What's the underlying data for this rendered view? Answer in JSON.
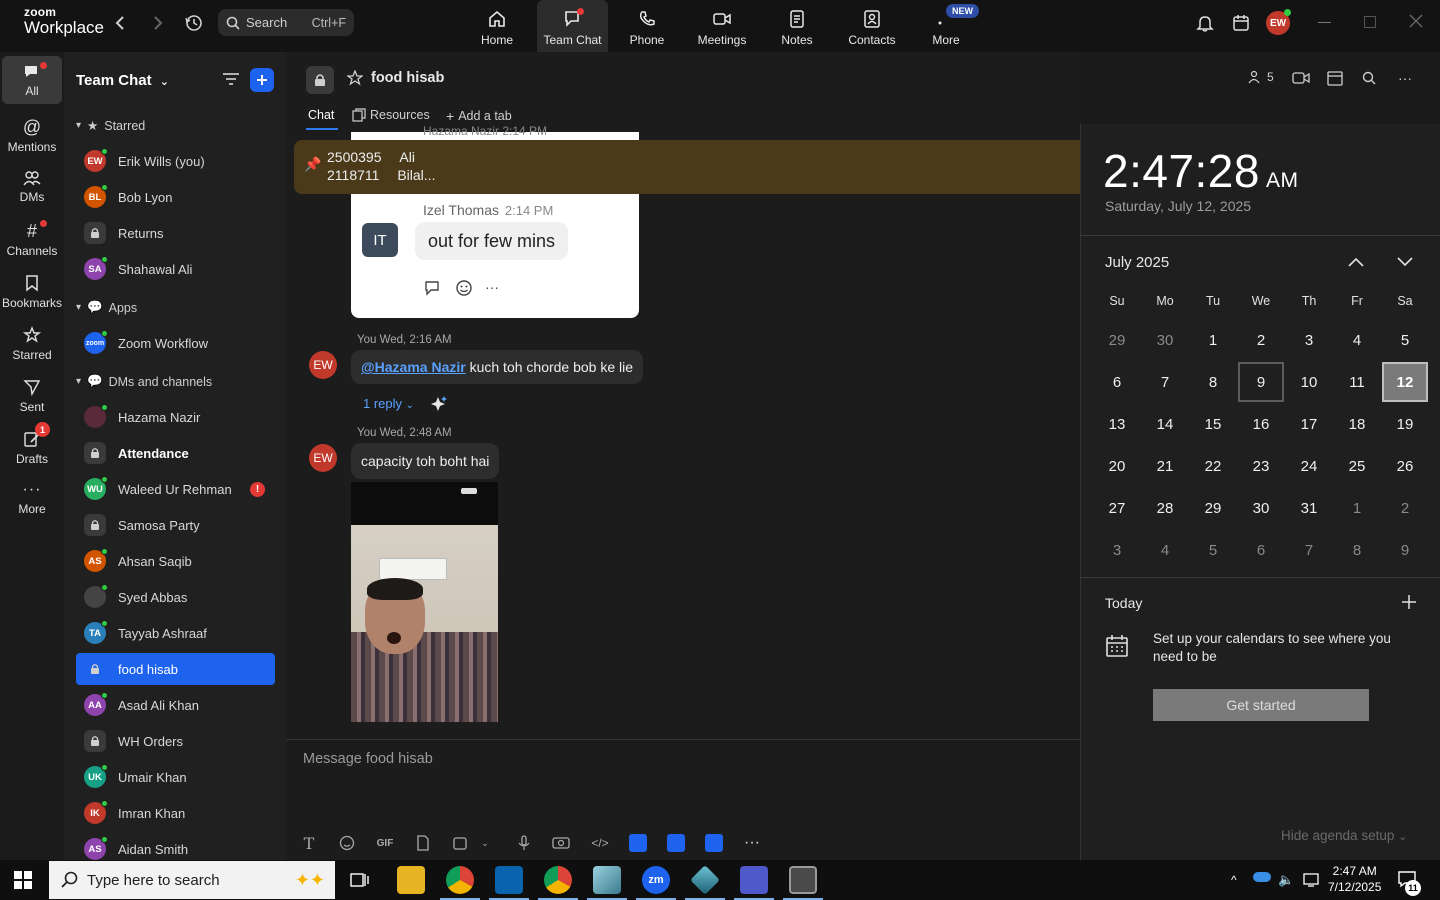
{
  "app": {
    "logo_line1": "zoom",
    "logo_line2": "Workplace"
  },
  "search": {
    "label": "Search",
    "shortcut": "Ctrl+F"
  },
  "topnav": [
    {
      "label": "Home"
    },
    {
      "label": "Team Chat"
    },
    {
      "label": "Phone"
    },
    {
      "label": "Meetings"
    },
    {
      "label": "Notes"
    },
    {
      "label": "Contacts"
    },
    {
      "label": "More",
      "badge": "NEW"
    }
  ],
  "profile": {
    "initials": "EW",
    "color": "#c0392b"
  },
  "rail": [
    {
      "label": "All"
    },
    {
      "label": "Mentions"
    },
    {
      "label": "DMs"
    },
    {
      "label": "Channels"
    },
    {
      "label": "Bookmarks"
    },
    {
      "label": "Starred"
    },
    {
      "label": "Sent"
    },
    {
      "label": "Drafts",
      "badge": "1"
    },
    {
      "label": "More"
    }
  ],
  "sidebar": {
    "title": "Team Chat",
    "sections": {
      "starred": "Starred",
      "apps": "Apps",
      "dms": "DMs and channels"
    },
    "starred": [
      {
        "initials": "EW",
        "name": "Erik Wills (you)",
        "color": "#c0392b"
      },
      {
        "initials": "BL",
        "name": "Bob Lyon",
        "color": "#d35400"
      },
      {
        "initials": "",
        "name": "Returns",
        "lock": true
      },
      {
        "initials": "SA",
        "name": "Shahawal Ali",
        "color": "#8e44ad"
      }
    ],
    "apps": [
      {
        "initials": "zoom",
        "name": "Zoom Workflow",
        "color": "#1d63ed"
      }
    ],
    "dms": [
      {
        "initials": "",
        "name": "Hazama Nazir",
        "color": "#5a2a3a"
      },
      {
        "initials": "",
        "name": "Attendance",
        "lock": true,
        "bold": true
      },
      {
        "initials": "WU",
        "name": "Waleed Ur Rehman",
        "color": "#27ae60",
        "alert": "!"
      },
      {
        "initials": "",
        "name": "Samosa Party",
        "lock": true
      },
      {
        "initials": "AS",
        "name": "Ahsan Saqib",
        "color": "#d35400"
      },
      {
        "initials": "",
        "name": "Syed Abbas",
        "color": "#444"
      },
      {
        "initials": "TA",
        "name": "Tayyab Ashraaf",
        "color": "#2980b9"
      },
      {
        "initials": "",
        "name": "food hisab",
        "lock": true,
        "selected": true
      },
      {
        "initials": "AA",
        "name": "Asad Ali Khan",
        "color": "#8e44ad"
      },
      {
        "initials": "",
        "name": "WH Orders",
        "lock": true
      },
      {
        "initials": "UK",
        "name": "Umair Khan",
        "color": "#16a085"
      },
      {
        "initials": "IK",
        "name": "Imran Khan",
        "color": "#c0392b"
      },
      {
        "initials": "AS",
        "name": "Aidan Smith",
        "color": "#8e44ad"
      }
    ]
  },
  "chat": {
    "channel_name": "food hisab",
    "members_count": "5",
    "tabs": {
      "chat": "Chat",
      "resources": "Resources",
      "add": "Add a tab"
    },
    "pinned": {
      "line1_code": "2500395",
      "line1_name": "Ali",
      "line2_code": "2118711",
      "line2_name": "Bilal..."
    },
    "quoted_card": {
      "header_partial": "Hazama Nazir 2:14 PM",
      "sender": "Izel Thomas",
      "time": "2:14 PM",
      "initials": "IT",
      "text": "out for few mins"
    },
    "messages": [
      {
        "initials": "EW",
        "meta": "You Wed, 2:16 AM",
        "mention": "@Hazama Nazir",
        "text": " kuch toh chorde bob ke lie",
        "reply": "1 reply"
      },
      {
        "initials": "EW",
        "meta": "You Wed, 2:48 AM",
        "text": "capacity toh boht hai"
      }
    ],
    "composer_placeholder": "Message food hisab"
  },
  "calendar": {
    "time": "2:47:28",
    "ampm": "AM",
    "date_long": "Saturday, July 12, 2025",
    "month_label": "July 2025",
    "weekdays": [
      "Su",
      "Mo",
      "Tu",
      "We",
      "Th",
      "Fr",
      "Sa"
    ],
    "weeks": [
      [
        "29",
        "30",
        "1",
        "2",
        "3",
        "4",
        "5"
      ],
      [
        "6",
        "7",
        "8",
        "9",
        "10",
        "11",
        "12"
      ],
      [
        "13",
        "14",
        "15",
        "16",
        "17",
        "18",
        "19"
      ],
      [
        "20",
        "21",
        "22",
        "23",
        "24",
        "25",
        "26"
      ],
      [
        "27",
        "28",
        "29",
        "30",
        "31",
        "1",
        "2"
      ],
      [
        "3",
        "4",
        "5",
        "6",
        "7",
        "8",
        "9"
      ]
    ],
    "today_label": "Today",
    "setup_text": "Set up your calendars to see where you need to be",
    "get_started": "Get started",
    "hide_agenda": "Hide agenda setup"
  },
  "taskbar": {
    "search_placeholder": "Type here to search",
    "clock_time": "2:47 AM",
    "clock_date": "7/12/2025",
    "notif_count": "11"
  }
}
